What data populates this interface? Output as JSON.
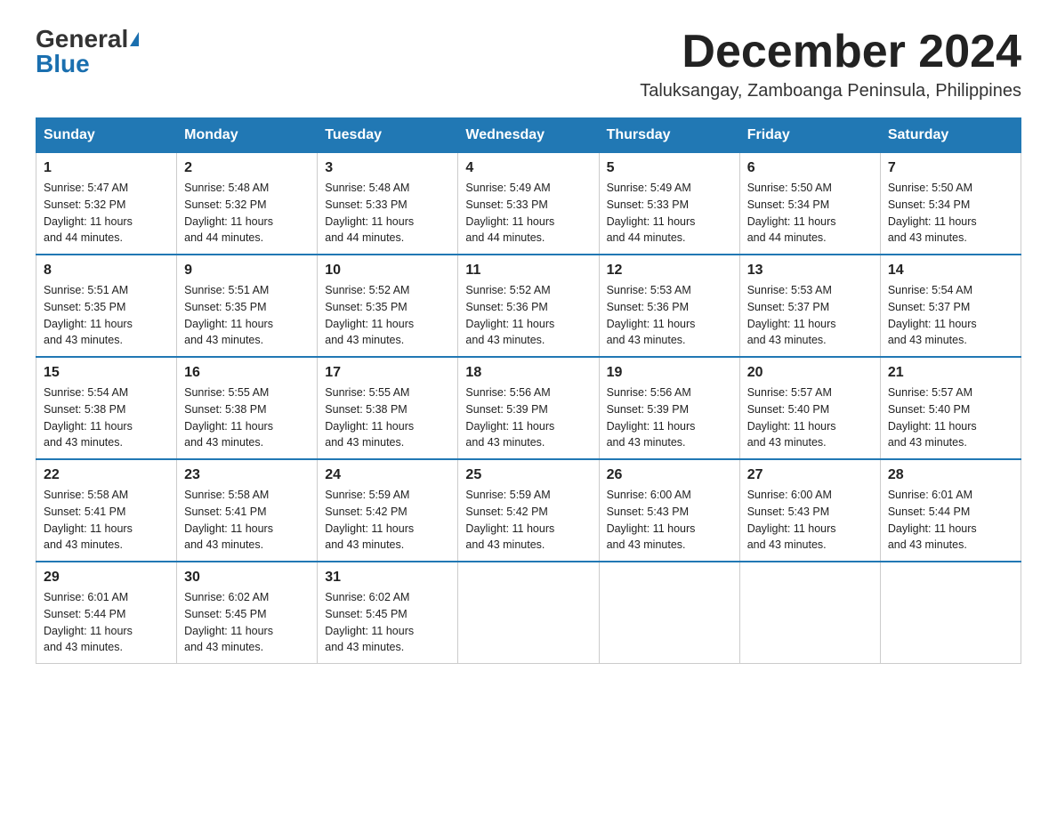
{
  "logo": {
    "general": "General",
    "blue": "Blue"
  },
  "title": "December 2024",
  "location": "Taluksangay, Zamboanga Peninsula, Philippines",
  "days_of_week": [
    "Sunday",
    "Monday",
    "Tuesday",
    "Wednesday",
    "Thursday",
    "Friday",
    "Saturday"
  ],
  "weeks": [
    [
      {
        "day": "1",
        "sunrise": "5:47 AM",
        "sunset": "5:32 PM",
        "daylight": "11 hours and 44 minutes."
      },
      {
        "day": "2",
        "sunrise": "5:48 AM",
        "sunset": "5:32 PM",
        "daylight": "11 hours and 44 minutes."
      },
      {
        "day": "3",
        "sunrise": "5:48 AM",
        "sunset": "5:33 PM",
        "daylight": "11 hours and 44 minutes."
      },
      {
        "day": "4",
        "sunrise": "5:49 AM",
        "sunset": "5:33 PM",
        "daylight": "11 hours and 44 minutes."
      },
      {
        "day": "5",
        "sunrise": "5:49 AM",
        "sunset": "5:33 PM",
        "daylight": "11 hours and 44 minutes."
      },
      {
        "day": "6",
        "sunrise": "5:50 AM",
        "sunset": "5:34 PM",
        "daylight": "11 hours and 44 minutes."
      },
      {
        "day": "7",
        "sunrise": "5:50 AM",
        "sunset": "5:34 PM",
        "daylight": "11 hours and 43 minutes."
      }
    ],
    [
      {
        "day": "8",
        "sunrise": "5:51 AM",
        "sunset": "5:35 PM",
        "daylight": "11 hours and 43 minutes."
      },
      {
        "day": "9",
        "sunrise": "5:51 AM",
        "sunset": "5:35 PM",
        "daylight": "11 hours and 43 minutes."
      },
      {
        "day": "10",
        "sunrise": "5:52 AM",
        "sunset": "5:35 PM",
        "daylight": "11 hours and 43 minutes."
      },
      {
        "day": "11",
        "sunrise": "5:52 AM",
        "sunset": "5:36 PM",
        "daylight": "11 hours and 43 minutes."
      },
      {
        "day": "12",
        "sunrise": "5:53 AM",
        "sunset": "5:36 PM",
        "daylight": "11 hours and 43 minutes."
      },
      {
        "day": "13",
        "sunrise": "5:53 AM",
        "sunset": "5:37 PM",
        "daylight": "11 hours and 43 minutes."
      },
      {
        "day": "14",
        "sunrise": "5:54 AM",
        "sunset": "5:37 PM",
        "daylight": "11 hours and 43 minutes."
      }
    ],
    [
      {
        "day": "15",
        "sunrise": "5:54 AM",
        "sunset": "5:38 PM",
        "daylight": "11 hours and 43 minutes."
      },
      {
        "day": "16",
        "sunrise": "5:55 AM",
        "sunset": "5:38 PM",
        "daylight": "11 hours and 43 minutes."
      },
      {
        "day": "17",
        "sunrise": "5:55 AM",
        "sunset": "5:38 PM",
        "daylight": "11 hours and 43 minutes."
      },
      {
        "day": "18",
        "sunrise": "5:56 AM",
        "sunset": "5:39 PM",
        "daylight": "11 hours and 43 minutes."
      },
      {
        "day": "19",
        "sunrise": "5:56 AM",
        "sunset": "5:39 PM",
        "daylight": "11 hours and 43 minutes."
      },
      {
        "day": "20",
        "sunrise": "5:57 AM",
        "sunset": "5:40 PM",
        "daylight": "11 hours and 43 minutes."
      },
      {
        "day": "21",
        "sunrise": "5:57 AM",
        "sunset": "5:40 PM",
        "daylight": "11 hours and 43 minutes."
      }
    ],
    [
      {
        "day": "22",
        "sunrise": "5:58 AM",
        "sunset": "5:41 PM",
        "daylight": "11 hours and 43 minutes."
      },
      {
        "day": "23",
        "sunrise": "5:58 AM",
        "sunset": "5:41 PM",
        "daylight": "11 hours and 43 minutes."
      },
      {
        "day": "24",
        "sunrise": "5:59 AM",
        "sunset": "5:42 PM",
        "daylight": "11 hours and 43 minutes."
      },
      {
        "day": "25",
        "sunrise": "5:59 AM",
        "sunset": "5:42 PM",
        "daylight": "11 hours and 43 minutes."
      },
      {
        "day": "26",
        "sunrise": "6:00 AM",
        "sunset": "5:43 PM",
        "daylight": "11 hours and 43 minutes."
      },
      {
        "day": "27",
        "sunrise": "6:00 AM",
        "sunset": "5:43 PM",
        "daylight": "11 hours and 43 minutes."
      },
      {
        "day": "28",
        "sunrise": "6:01 AM",
        "sunset": "5:44 PM",
        "daylight": "11 hours and 43 minutes."
      }
    ],
    [
      {
        "day": "29",
        "sunrise": "6:01 AM",
        "sunset": "5:44 PM",
        "daylight": "11 hours and 43 minutes."
      },
      {
        "day": "30",
        "sunrise": "6:02 AM",
        "sunset": "5:45 PM",
        "daylight": "11 hours and 43 minutes."
      },
      {
        "day": "31",
        "sunrise": "6:02 AM",
        "sunset": "5:45 PM",
        "daylight": "11 hours and 43 minutes."
      },
      null,
      null,
      null,
      null
    ]
  ],
  "labels": {
    "sunrise": "Sunrise:",
    "sunset": "Sunset:",
    "daylight": "Daylight:"
  }
}
